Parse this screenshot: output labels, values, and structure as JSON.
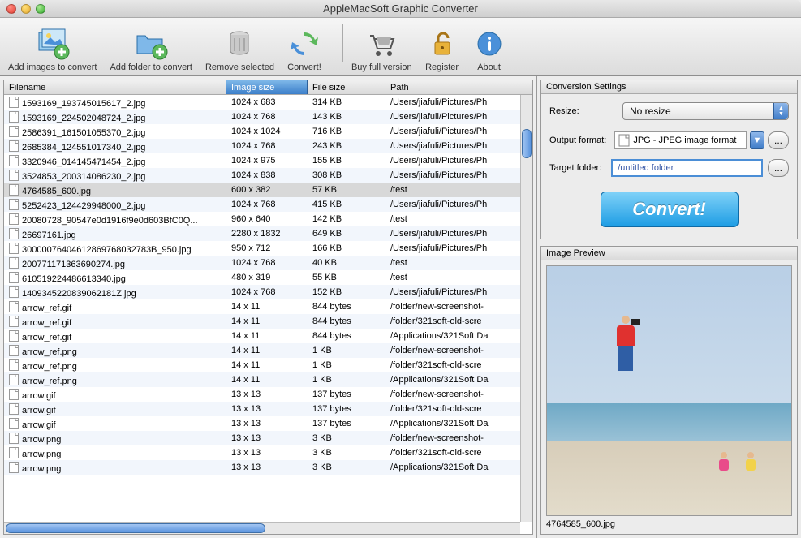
{
  "window": {
    "title": "AppleMacSoft Graphic Converter"
  },
  "toolbar": {
    "add_images": "Add images to convert",
    "add_folder": "Add folder to convert",
    "remove_selected": "Remove selected",
    "convert": "Convert!",
    "buy_full": "Buy full version",
    "register": "Register",
    "about": "About"
  },
  "table": {
    "headers": {
      "filename": "Filename",
      "image_size": "Image size",
      "file_size": "File size",
      "path": "Path"
    },
    "selected_index": 6,
    "rows": [
      {
        "fn": "1593169_193745015617_2.jpg",
        "is": "1024 x 683",
        "fs": "314 KB",
        "pa": "/Users/jiafuli/Pictures/Ph"
      },
      {
        "fn": "1593169_224502048724_2.jpg",
        "is": "1024 x 768",
        "fs": "143 KB",
        "pa": "/Users/jiafuli/Pictures/Ph"
      },
      {
        "fn": "2586391_161501055370_2.jpg",
        "is": "1024 x 1024",
        "fs": "716 KB",
        "pa": "/Users/jiafuli/Pictures/Ph"
      },
      {
        "fn": "2685384_124551017340_2.jpg",
        "is": "1024 x 768",
        "fs": "243 KB",
        "pa": "/Users/jiafuli/Pictures/Ph"
      },
      {
        "fn": "3320946_014145471454_2.jpg",
        "is": "1024 x 975",
        "fs": "155 KB",
        "pa": "/Users/jiafuli/Pictures/Ph"
      },
      {
        "fn": "3524853_200314086230_2.jpg",
        "is": "1024 x 838",
        "fs": "308 KB",
        "pa": "/Users/jiafuli/Pictures/Ph"
      },
      {
        "fn": "4764585_600.jpg",
        "is": "600 x 382",
        "fs": "57 KB",
        "pa": "/test"
      },
      {
        "fn": "5252423_124429948000_2.jpg",
        "is": "1024 x 768",
        "fs": "415 KB",
        "pa": "/Users/jiafuli/Pictures/Ph"
      },
      {
        "fn": "20080728_90547e0d1916f9e0d603BfC0Q...",
        "is": "960 x 640",
        "fs": "142 KB",
        "pa": "/test"
      },
      {
        "fn": "26697161.jpg",
        "is": "2280 x 1832",
        "fs": "649 KB",
        "pa": "/Users/jiafuli/Pictures/Ph"
      },
      {
        "fn": "30000076404612869768032783B_950.jpg",
        "is": "950 x 712",
        "fs": "166 KB",
        "pa": "/Users/jiafuli/Pictures/Ph"
      },
      {
        "fn": "200771171363690274.jpg",
        "is": "1024 x 768",
        "fs": "40 KB",
        "pa": "/test"
      },
      {
        "fn": "610519224486613340.jpg",
        "is": "480 x 319",
        "fs": "55 KB",
        "pa": "/test"
      },
      {
        "fn": "1409345220839062181Z.jpg",
        "is": "1024 x 768",
        "fs": "152 KB",
        "pa": "/Users/jiafuli/Pictures/Ph"
      },
      {
        "fn": "arrow_ref.gif",
        "is": "14 x 11",
        "fs": "844 bytes",
        "pa": "/folder/new-screenshot-"
      },
      {
        "fn": "arrow_ref.gif",
        "is": "14 x 11",
        "fs": "844 bytes",
        "pa": "/folder/321soft-old-scre"
      },
      {
        "fn": "arrow_ref.gif",
        "is": "14 x 11",
        "fs": "844 bytes",
        "pa": "/Applications/321Soft Da"
      },
      {
        "fn": "arrow_ref.png",
        "is": "14 x 11",
        "fs": "1 KB",
        "pa": "/folder/new-screenshot-"
      },
      {
        "fn": "arrow_ref.png",
        "is": "14 x 11",
        "fs": "1 KB",
        "pa": "/folder/321soft-old-scre"
      },
      {
        "fn": "arrow_ref.png",
        "is": "14 x 11",
        "fs": "1 KB",
        "pa": "/Applications/321Soft Da"
      },
      {
        "fn": "arrow.gif",
        "is": "13 x 13",
        "fs": "137 bytes",
        "pa": "/folder/new-screenshot-"
      },
      {
        "fn": "arrow.gif",
        "is": "13 x 13",
        "fs": "137 bytes",
        "pa": "/folder/321soft-old-scre"
      },
      {
        "fn": "arrow.gif",
        "is": "13 x 13",
        "fs": "137 bytes",
        "pa": "/Applications/321Soft Da"
      },
      {
        "fn": "arrow.png",
        "is": "13 x 13",
        "fs": "3 KB",
        "pa": "/folder/new-screenshot-"
      },
      {
        "fn": "arrow.png",
        "is": "13 x 13",
        "fs": "3 KB",
        "pa": "/folder/321soft-old-scre"
      },
      {
        "fn": "arrow.png",
        "is": "13 x 13",
        "fs": "3 KB",
        "pa": "/Applications/321Soft Da"
      }
    ]
  },
  "settings": {
    "panel_title": "Conversion Settings",
    "resize_label": "Resize:",
    "resize_value": "No resize",
    "output_format_label": "Output format:",
    "output_format_value": "JPG - JPEG image format",
    "target_folder_label": "Target folder:",
    "target_folder_value": "/untitled folder",
    "browse": "...",
    "convert_button": "Convert!"
  },
  "preview": {
    "panel_title": "Image Preview",
    "filename": "4764585_600.jpg"
  }
}
